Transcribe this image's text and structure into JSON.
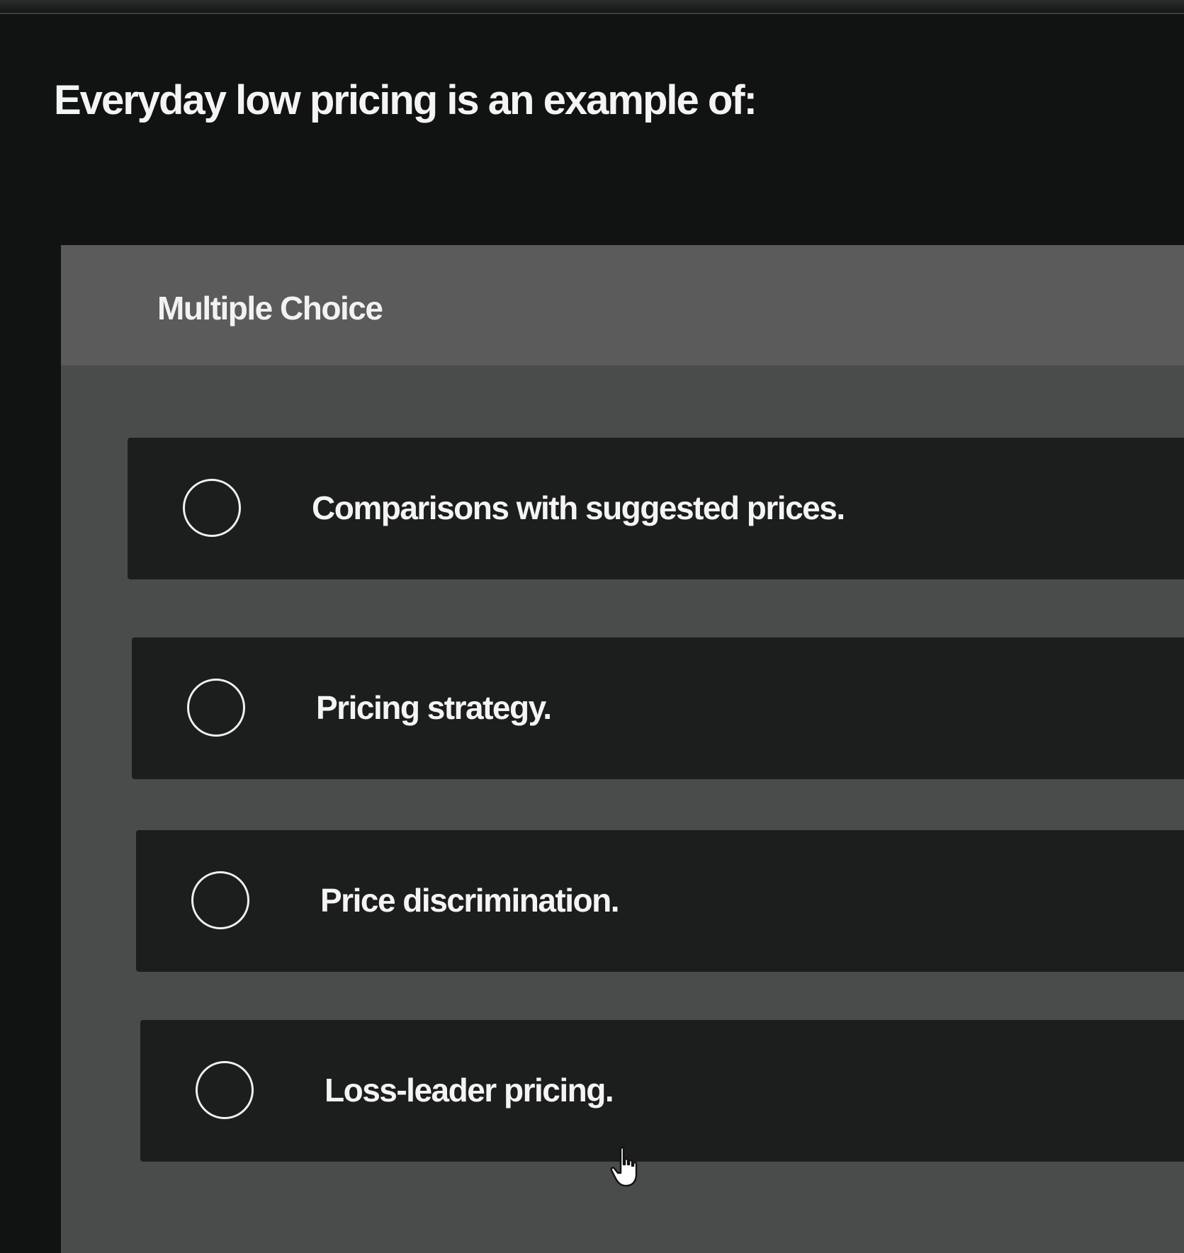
{
  "question": {
    "text": "Everyday low pricing is an example of:"
  },
  "panel": {
    "type_label": "Multiple Choice"
  },
  "options": [
    {
      "label": "Comparisons with suggested prices."
    },
    {
      "label": "Pricing strategy."
    },
    {
      "label": "Price discrimination."
    },
    {
      "label": "Loss-leader pricing."
    }
  ],
  "colors": {
    "page_background": "#111212",
    "panel_background": "#4a4b4b",
    "panel_header": "#5a5b5a",
    "option_background": "#1c1d1d",
    "text": "#f4f4f4"
  },
  "icons": {
    "radio": "radio-empty-icon",
    "cursor": "hand-pointer-icon"
  }
}
